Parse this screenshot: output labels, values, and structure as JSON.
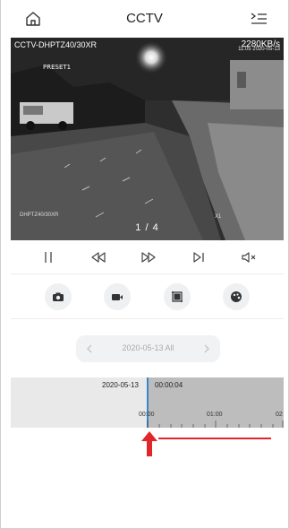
{
  "header": {
    "title": "CCTV",
    "home_icon": "home-icon",
    "menu_icon": "list-menu-icon"
  },
  "video": {
    "camera_name": "CCTV-DHPTZ40/30XR",
    "bitrate": "2280KB/s",
    "timestamp": "11:05 2020-05-13",
    "preset_label": "PRESET1",
    "osd_name": "DHPTZ40/30XR",
    "zoom_label": "X1",
    "pager": "1 / 4"
  },
  "controls": [
    {
      "name": "pause-button",
      "icon": "pause-icon"
    },
    {
      "name": "rewind-button",
      "icon": "rewind-icon"
    },
    {
      "name": "fast-forward-button",
      "icon": "fast-forward-icon"
    },
    {
      "name": "next-frame-button",
      "icon": "step-forward-icon"
    },
    {
      "name": "mute-button",
      "icon": "speaker-muted-icon"
    }
  ],
  "tools": [
    {
      "name": "snapshot-button",
      "icon": "camera-icon"
    },
    {
      "name": "record-button",
      "icon": "video-camera-icon"
    },
    {
      "name": "crop-button",
      "icon": "crop-icon"
    },
    {
      "name": "digital-zoom-button",
      "icon": "palette-icon"
    }
  ],
  "date_selector": {
    "text": "2020-05-13  All",
    "prev_icon": "chevron-left-icon",
    "next_icon": "chevron-right-icon"
  },
  "timeline": {
    "date": "2020-05-13",
    "time": "00:00:04",
    "labels": [
      "00:00",
      "01:00",
      "02"
    ]
  },
  "annotation": {
    "color": "#e0262b"
  }
}
